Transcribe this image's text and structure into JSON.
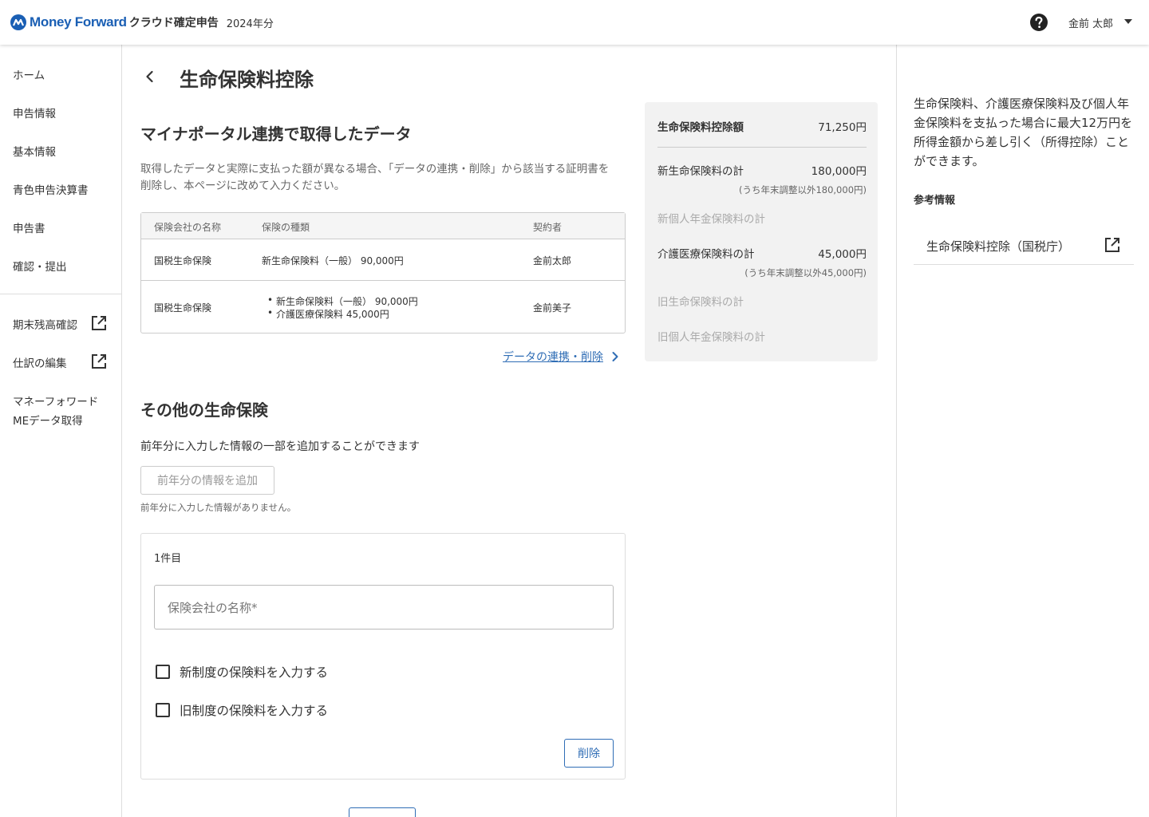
{
  "header": {
    "brand": "Money Forward",
    "product": "クラウド確定申告",
    "year": "2024年分",
    "user_name": "金前 太郎"
  },
  "sidebar": {
    "items": [
      "ホーム",
      "申告情報",
      "基本情報",
      "青色申告決算書",
      "申告書",
      "確認・提出"
    ],
    "external_items": [
      "期末残高確認",
      "仕訳の編集"
    ],
    "me_line1": "マネーフォワード",
    "me_line2": "MEデータ取得"
  },
  "page": {
    "title": "生命保険料控除"
  },
  "mynaportal": {
    "title": "マイナポータル連携で取得したデータ",
    "desc": "取得したデータと実際に支払った額が異なる場合、「データの連携・削除」から該当する証明書を削除し、本ページに改めて入力ください。",
    "columns": [
      "保険会社の名称",
      "保険の種類",
      "契約者"
    ],
    "rows": [
      {
        "company": "国税生命保険",
        "types": [
          "新生命保険料（一般） 90,000円"
        ],
        "holder": "金前太郎"
      },
      {
        "company": "国税生命保険",
        "types": [
          "新生命保険料（一般） 90,000円",
          "介護医療保険料 45,000円"
        ],
        "holder": "金前美子"
      }
    ],
    "link_label": "データの連携・削除"
  },
  "other": {
    "title": "その他の生命保険",
    "desc": "前年分に入力した情報の一部を追加することができます",
    "prev_button": "前年分の情報を追加",
    "prev_note": "前年分に入力した情報がありません。",
    "entry": {
      "number": "1件目",
      "company_placeholder": "保険会社の名称*",
      "check_new": "新制度の保険料を入力する",
      "check_old": "旧制度の保険料を入力する",
      "delete_button": "削除"
    }
  },
  "summary": {
    "deduction_label": "生命保険料控除額",
    "deduction_value": "71,250円",
    "new_life_label": "新生命保険料の計",
    "new_life_value": "180,000円",
    "new_life_sub": "(うち年末調整以外180,000円)",
    "new_pension_label": "新個人年金保険料の計",
    "care_label": "介護医療保険料の計",
    "care_value": "45,000円",
    "care_sub": "(うち年末調整以外45,000円)",
    "old_life_label": "旧生命保険料の計",
    "old_pension_label": "旧個人年金保険料の計"
  },
  "right_panel": {
    "desc": "生命保険料、介護医療保険料及び個人年金保険料を支払った場合に最大12万円を所得金額から差し引く（所得控除）ことができます。",
    "ref_title": "参考情報",
    "ref_link": "生命保険料控除（国税庁）"
  }
}
